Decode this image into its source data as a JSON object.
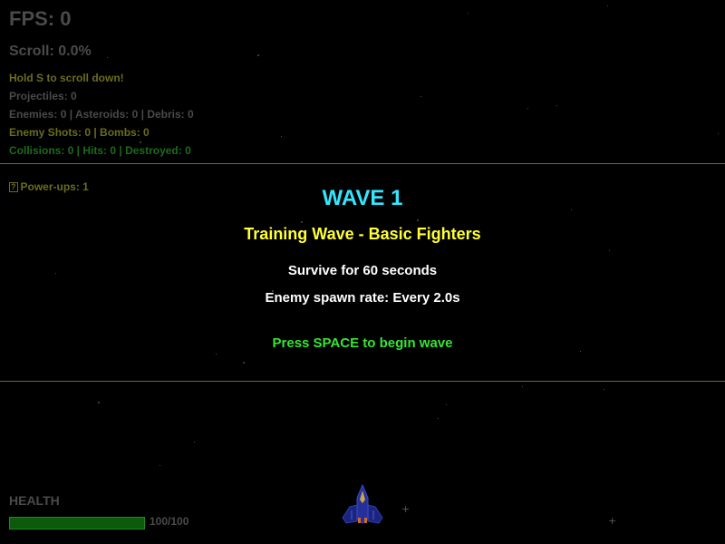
{
  "hud": {
    "fps": "FPS: 0",
    "scroll": "Scroll: 0.0%",
    "hint": "Hold S to scroll down!",
    "projectiles": "Projectiles: 0",
    "entities": "Enemies: 0 | Asteroids: 0 | Debris: 0",
    "enemy_shots": "Enemy Shots: 0 | Bombs: 0",
    "collisions": "Collisions: 0 | Hits: 0 | Destroyed: 0",
    "powerups_icon": "?",
    "powerups": "Power-ups: 1"
  },
  "wave_banner": {
    "title": "WAVE 1",
    "subtitle": "Training Wave - Basic Fighters",
    "objective": "Survive for 60 seconds",
    "spawn_rate": "Enemy spawn rate: Every 2.0s",
    "prompt": "Press SPACE to begin wave"
  },
  "health": {
    "label": "HEALTH",
    "value_text": "100/100",
    "fraction": 1.0
  },
  "player": {
    "icon": "spaceship-icon"
  },
  "colors": {
    "background": "#000000",
    "wave_title": "#33e6ff",
    "wave_subtitle": "#ffff33",
    "prompt": "#33e633",
    "health_fill": "#0c5a0c",
    "health_border": "#1c8a1c",
    "divider": "#6b6b1e"
  }
}
